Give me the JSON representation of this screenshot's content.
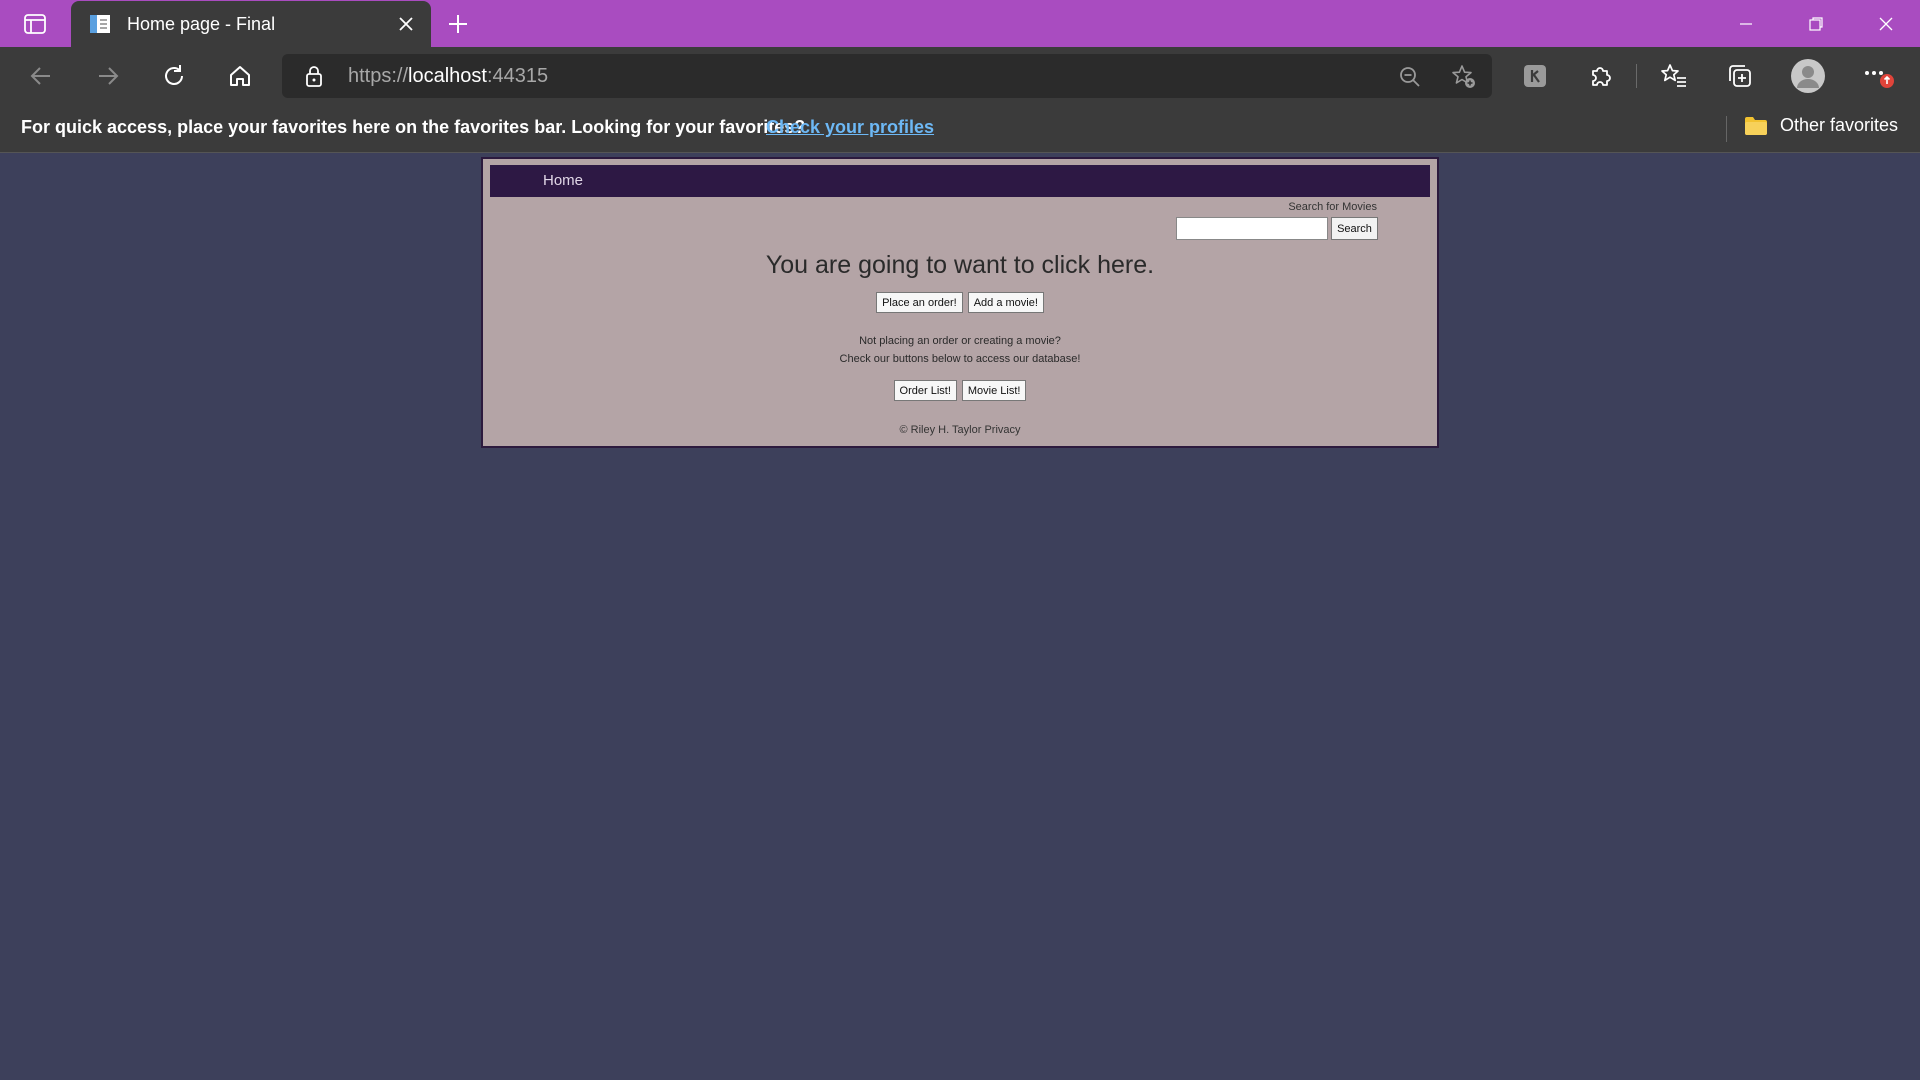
{
  "browser": {
    "tab": {
      "title": "Home page - Final"
    },
    "address_bar": {
      "scheme": "https://",
      "host": "localhost",
      "port": ":44315"
    },
    "favorites_bar": {
      "message": "For quick access, place your favorites here on the favorites bar. Looking for your favorites?",
      "link": "Check your profiles",
      "other_favorites": "Other favorites"
    },
    "icons": {
      "tab_actions": "tab-actions-icon",
      "favicon": "page-favicon-icon",
      "close_tab": "close-icon",
      "new_tab": "plus-icon",
      "back": "back-arrow-icon",
      "forward": "forward-arrow-icon",
      "refresh": "refresh-icon",
      "home": "home-icon",
      "lock": "lock-icon",
      "zoom": "zoom-out-icon",
      "add_favorite": "star-add-icon",
      "extension": "extension-puzzle-icon",
      "favorites": "favorites-star-icon",
      "collections": "collections-icon",
      "profile": "profile-avatar-icon",
      "more": "more-menu-icon",
      "folder": "folder-icon"
    },
    "colors": {
      "frame": "#a94cc0",
      "toolbar": "#3b3b3b",
      "link": "#6db8f5",
      "badge": "#e0443a"
    }
  },
  "site": {
    "nav": {
      "home": "Home"
    },
    "search": {
      "label": "Search for Movies",
      "button": "Search",
      "value": ""
    },
    "headline": "You are going to want to click here.",
    "primary_buttons": {
      "place_order": "Place an order!",
      "add_movie": "Add a movie!"
    },
    "note_line1": "Not placing an order or creating a movie?",
    "note_line2": "Check our buttons below to access our database!",
    "secondary_buttons": {
      "order_list": "Order List!",
      "movie_list": "Movie List!"
    },
    "footer": {
      "copyright": "© Riley H. Taylor",
      "privacy": "Privacy"
    },
    "colors": {
      "page_bg": "#3d405b",
      "container_bg": "#b4a4a6",
      "nav_bg": "#2d1844"
    }
  }
}
